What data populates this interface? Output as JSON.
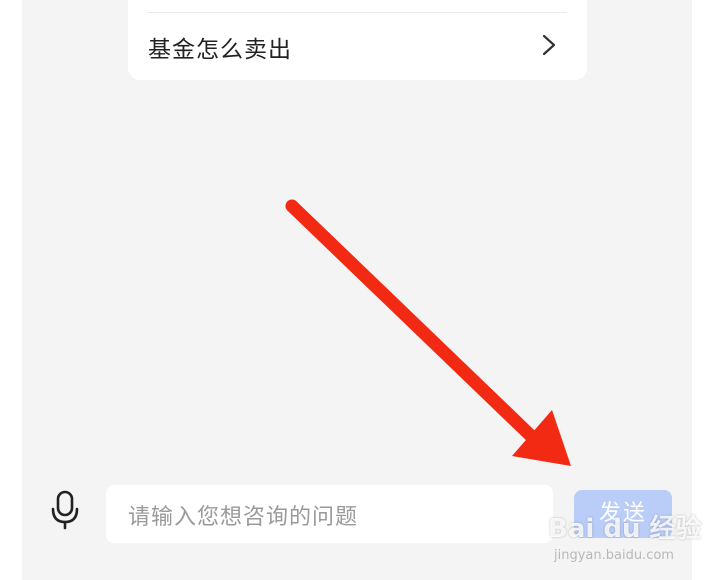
{
  "card": {
    "question": "基金怎么卖出",
    "chevron_icon": "chevron-right-icon"
  },
  "input": {
    "placeholder": "请输入您想咨询的问题",
    "mic_icon": "microphone-icon",
    "send_label": "发送"
  },
  "watermark": {
    "text": "Bai du 经验",
    "url": "jingyan.baidu.com"
  },
  "colors": {
    "arrow": "#f22a14",
    "send_bg": "#b9cdf8",
    "chat_bg": "#f4f4f4"
  }
}
